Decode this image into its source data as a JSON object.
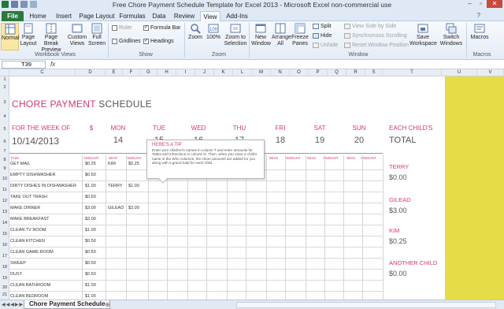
{
  "window": {
    "title": "Free Chore Payment Schedule Template for Excel 2013  -  Microsoft Excel non-commercial use"
  },
  "tabs": [
    "File",
    "Home",
    "Insert",
    "Page Layout",
    "Formulas",
    "Data",
    "Review",
    "View",
    "Add-Ins"
  ],
  "active_tab": "View",
  "ribbon": {
    "workbook_views": {
      "normal": "Normal",
      "page_layout": "Page Layout",
      "page_break": "Page Break Preview",
      "custom_views": "Custom Views",
      "full_screen": "Full Screen",
      "group_label": "Workbook Views"
    },
    "show": {
      "ruler": "Ruler",
      "formula_bar": "Formula Bar",
      "gridlines": "Gridlines",
      "headings": "Headings",
      "group_label": "Show"
    },
    "zoom": {
      "zoom": "Zoom",
      "hundred": "100%",
      "zoom_selection": "Zoom to Selection",
      "group_label": "Zoom"
    },
    "window": {
      "new_window": "New Window",
      "arrange_all": "Arrange All",
      "freeze_panes": "Freeze Panes",
      "split": "Split",
      "hide": "Hide",
      "unhide": "Unhide",
      "side_by_side": "View Side by Side",
      "sync_scroll": "Synchronous Scrolling",
      "reset_position": "Reset Window Position",
      "save_workspace": "Save Workspace",
      "switch_windows": "Switch Windows",
      "group_label": "Window"
    },
    "macros": {
      "macros": "Macros",
      "group_label": "Macros"
    }
  },
  "formula_bar": {
    "cell_ref": "T39",
    "fx": "fx"
  },
  "column_headers": [
    "C",
    "D",
    "E",
    "F",
    "G",
    "H",
    "I",
    "J",
    "K",
    "L",
    "M",
    "N",
    "O",
    "P",
    "Q",
    "R",
    "S",
    "T",
    "U",
    "V"
  ],
  "row_headers": [
    "1",
    "2",
    "3",
    "4",
    "5",
    "6",
    "7",
    "8",
    "9",
    "10",
    "11",
    "12",
    "13",
    "14",
    "15",
    "16",
    "17",
    "18",
    "19",
    "20",
    "21",
    "22"
  ],
  "sheet": {
    "title_pink": "CHORE PAYMENT",
    "title_gray": "SCHEDULE",
    "week_label": "FOR THE WEEK OF",
    "week_date": "10/14/2013",
    "dollar": "$",
    "days": [
      {
        "name": "MON",
        "num": "14"
      },
      {
        "name": "TUE",
        "num": "15"
      },
      {
        "name": "WED",
        "num": "16"
      },
      {
        "name": "THU",
        "num": "17"
      },
      {
        "name": "FRI",
        "num": "18"
      },
      {
        "name": "SAT",
        "num": "19"
      },
      {
        "name": "SUN",
        "num": "20"
      }
    ],
    "each_child": "EACH CHILD'S",
    "total": "TOTAL",
    "task_hdr": "TASK",
    "amount_hdr": "AMOUNT",
    "who_hdr": "WHO",
    "tasks": [
      {
        "task": "GET MAIL",
        "amount": "$0.25",
        "who": "KIM",
        "wamt": "$0.25"
      },
      {
        "task": "EMPTY DISHWASHER",
        "amount": "$0.50",
        "who": "",
        "wamt": ""
      },
      {
        "task": "DIRTY DISHES IN DISHWASHER",
        "amount": "$1.00",
        "who": "TERRY",
        "wamt": "$1.00"
      },
      {
        "task": "TAKE OUT TRASH",
        "amount": "$0.50",
        "who": "",
        "wamt": ""
      },
      {
        "task": "MAKE DINNER",
        "amount": "$3.00",
        "who": "GILEAD",
        "wamt": "$3.00"
      },
      {
        "task": "MAKE BREAKFAST",
        "amount": "$2.00",
        "who": "",
        "wamt": ""
      },
      {
        "task": "CLEAN TV ROOM",
        "amount": "$1.00",
        "who": "",
        "wamt": ""
      },
      {
        "task": "CLEAN KITCHEN",
        "amount": "$0.50",
        "who": "",
        "wamt": ""
      },
      {
        "task": "CLEAN GAME ROOM",
        "amount": "$0.50",
        "who": "",
        "wamt": ""
      },
      {
        "task": "SWEEP",
        "amount": "$0.50",
        "who": "",
        "wamt": ""
      },
      {
        "task": "DUST",
        "amount": "$0.50",
        "who": "",
        "wamt": ""
      },
      {
        "task": "CLEAN BATHROOM",
        "amount": "$1.00",
        "who": "",
        "wamt": ""
      },
      {
        "task": "CLEAN BEDROOM",
        "amount": "$1.00",
        "who": "",
        "wamt": ""
      }
    ],
    "tip": {
      "heading": "HERE'S A TIP",
      "text": "Enter your children's names in column T and enter amounts for Tasks and Infractions in column D. Then, when you enter a child's name in the Who columns, the chore amounts are added for you along with a grand total for each child."
    },
    "children": [
      {
        "name": "TERRY",
        "value": "$0.00"
      },
      {
        "name": "GILEAD",
        "value": "$3.00"
      },
      {
        "name": "KIM",
        "value": "$0.25"
      },
      {
        "name": "ANOTHER CHILD",
        "value": "$0.00"
      }
    ]
  },
  "sheet_tabs": {
    "active": "Chore Payment Schedule"
  },
  "colors": {
    "accent_pink": "#d63877",
    "file_tab": "#2a7a3b",
    "yellow_fill": "#e6dc47"
  }
}
